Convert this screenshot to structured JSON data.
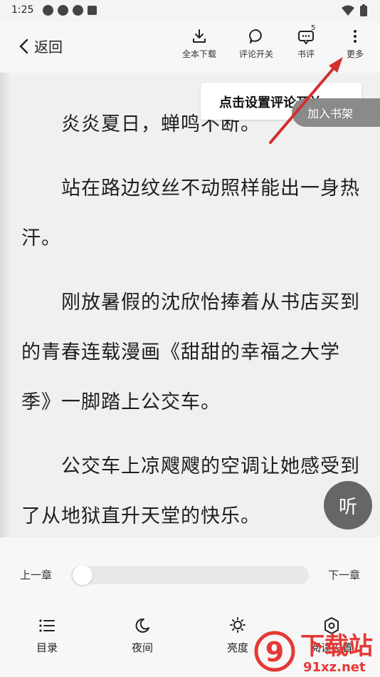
{
  "status": {
    "time": "1:25"
  },
  "topbar": {
    "back_label": "返回",
    "tools": [
      {
        "label": "全本下载",
        "icon": "download-icon"
      },
      {
        "label": "评论开关",
        "icon": "comment-icon"
      },
      {
        "label": "书评",
        "icon": "book-review-icon",
        "badge": "5"
      },
      {
        "label": "更多",
        "icon": "more-vertical-icon"
      }
    ]
  },
  "tooltip": {
    "text": "点击设置评论开关"
  },
  "shelf_button": "加入书架",
  "listen_button": "听",
  "content": {
    "paragraphs": [
      "　　炎炎夏日，蝉鸣不断。",
      "　　站在路边纹丝不动照样能出一身热汗。",
      "　　刚放暑假的沈欣怡捧着从书店买到的青春连载漫画《甜甜的幸福之大学季》一脚踏上公交车。",
      "　　公交车上凉飕飕的空调让她感受到了从地狱直升天堂的快乐。"
    ]
  },
  "chapter_nav": {
    "prev": "上一章",
    "next": "下一章",
    "progress": 0.0
  },
  "bottom_nav": [
    {
      "label": "目录",
      "icon": "list-icon"
    },
    {
      "label": "夜间",
      "icon": "moon-icon"
    },
    {
      "label": "亮度",
      "icon": "brightness-icon"
    },
    {
      "label": "阅读设置",
      "icon": "settings-icon"
    }
  ],
  "watermark": {
    "brand": "下载站",
    "url": "91xz.net",
    "logo": "9"
  },
  "colors": {
    "arrow": "#d32f2f",
    "watermark": "#e53935",
    "listen_bg": "#666666",
    "shelf_bg": "#8a8a8a"
  }
}
